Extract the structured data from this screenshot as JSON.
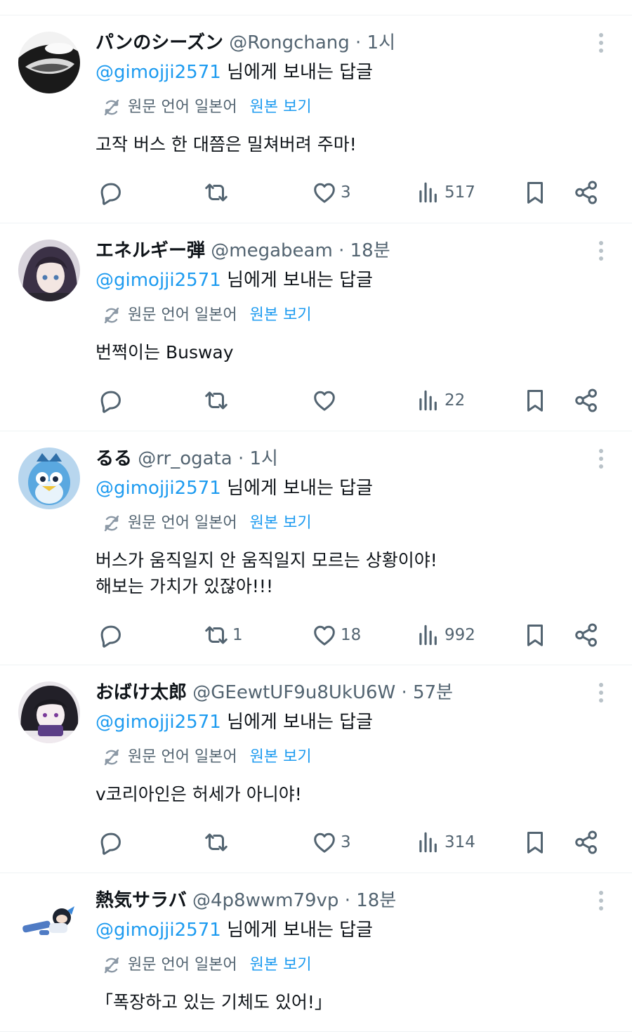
{
  "icon_names": [
    "translate-icon",
    "more-icon",
    "reply-icon",
    "retweet-icon",
    "like-icon",
    "views-icon",
    "bookmark-icon",
    "share-icon"
  ],
  "colors": {
    "link": "#1d9bf0",
    "secondary_text": "#536471",
    "primary_text": "#0f1419",
    "divider": "#eff3f4"
  },
  "tweets": [
    {
      "display_name": "パンのシーズン",
      "handle": "@Rongchang",
      "dot": "·",
      "time": "1시",
      "reply_mention": "@gimojji2571",
      "reply_suffix": "님에게 보내는 답글",
      "translate_label": "원문 언어 일본어",
      "translate_link": "원본 보기",
      "text_lines": [
        "고작 버스 한 대쯤은 밀쳐버려 주마!"
      ],
      "retweets": "",
      "likes": "3",
      "views": "517"
    },
    {
      "display_name": "エネルギー弾",
      "handle": "@megabeam",
      "dot": "·",
      "time": "18분",
      "reply_mention": "@gimojji2571",
      "reply_suffix": "님에게 보내는 답글",
      "translate_label": "원문 언어 일본어",
      "translate_link": "원본 보기",
      "text_lines": [
        "번쩍이는 Busway"
      ],
      "retweets": "",
      "likes": "",
      "views": "22"
    },
    {
      "display_name": "るる",
      "handle": "@rr_ogata",
      "dot": "·",
      "time": "1시",
      "reply_mention": "@gimojji2571",
      "reply_suffix": "님에게 보내는 답글",
      "translate_label": "원문 언어 일본어",
      "translate_link": "원본 보기",
      "text_lines": [
        "버스가 움직일지 안 움직일지 모르는 상황이야!",
        "해보는 가치가 있잖아!!!"
      ],
      "retweets": "1",
      "likes": "18",
      "views": "992"
    },
    {
      "display_name": "おばけ太郎",
      "handle": "@GEewtUF9u8UkU6W",
      "dot": "·",
      "time": "57분",
      "reply_mention": "@gimojji2571",
      "reply_suffix": "님에게 보내는 답글",
      "translate_label": "원문 언어 일본어",
      "translate_link": "원본 보기",
      "text_lines": [
        "v코리아인은 허세가 아니야!"
      ],
      "retweets": "",
      "likes": "3",
      "views": "314"
    },
    {
      "display_name": "熱気サラバ",
      "handle": "@4p8wwm79vp",
      "dot": "·",
      "time": "18분",
      "reply_mention": "@gimojji2571",
      "reply_suffix": "님에게 보내는 답글",
      "translate_label": "원문 언어 일본어",
      "translate_link": "원본 보기",
      "text_lines": [
        "「폭장하고 있는 기체도 있어!」"
      ],
      "retweets": "",
      "likes": "",
      "views": ""
    }
  ]
}
